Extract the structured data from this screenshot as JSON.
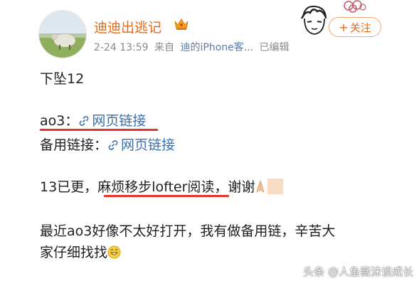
{
  "post": {
    "username": "迪迪出逃记",
    "date": "2-24 13:59",
    "source_prefix": "来自",
    "source": "迪的iPhone客...",
    "edited": "已编辑",
    "follow_plus": "+",
    "follow_label": "关注"
  },
  "content": {
    "line1": "下坠12",
    "ao3_label": "ao3：",
    "link_text": "网页链接",
    "backup_label": "备用链接：",
    "update_prefix": "13已更，",
    "update_highlight": "麻烦移步lofter阅读",
    "update_suffix": "，谢谢",
    "para_line1": "最近ao3好像不太好打开，我有做备用链，辛苦大",
    "para_line2": "家仔细找找"
  },
  "watermark": "头条 @人鱼薇沫谈成长",
  "colors": {
    "username": "#e86a15",
    "link": "#3d6fa8",
    "underline": "#e6342c",
    "meta": "#8a8a8a"
  },
  "icons": [
    "crown-icon",
    "link-icon",
    "praying-hands-emoji",
    "smile-emoji"
  ]
}
